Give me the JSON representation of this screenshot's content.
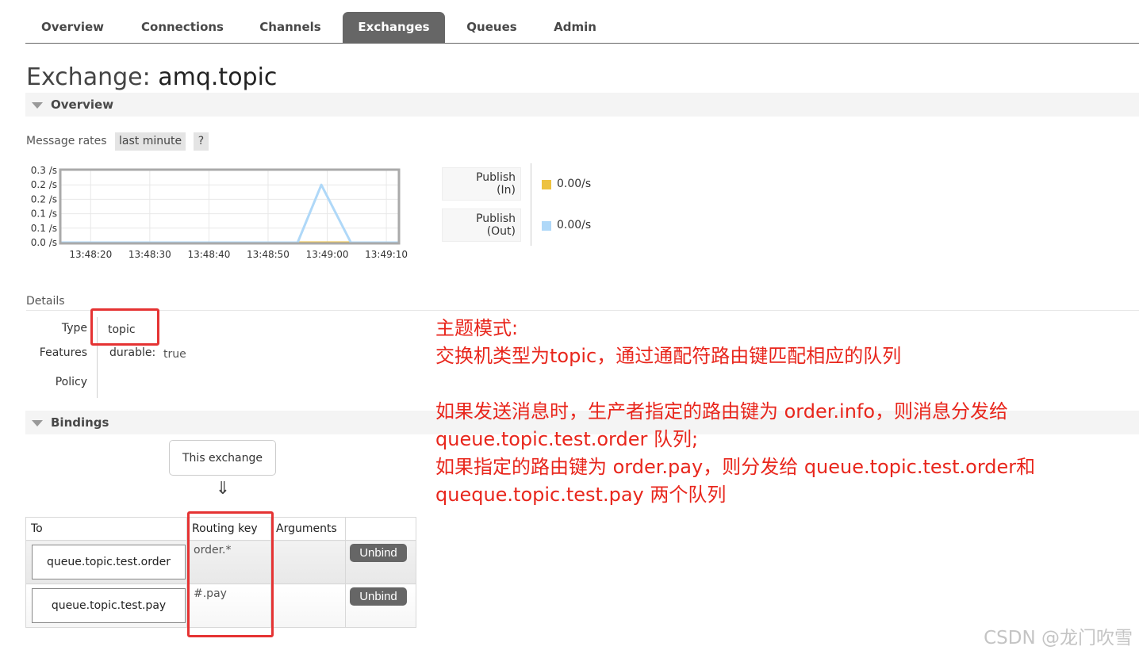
{
  "nav": {
    "tabs": [
      {
        "label": "Overview",
        "active": false
      },
      {
        "label": "Connections",
        "active": false
      },
      {
        "label": "Channels",
        "active": false
      },
      {
        "label": "Exchanges",
        "active": true
      },
      {
        "label": "Queues",
        "active": false
      },
      {
        "label": "Admin",
        "active": false
      }
    ]
  },
  "page": {
    "title_prefix": "Exchange:",
    "title_name": "amq.topic"
  },
  "overview": {
    "header": "Overview",
    "rates_label": "Message rates",
    "rates_range": "last minute",
    "rates_help": "?"
  },
  "chart_data": {
    "type": "line",
    "title": "",
    "xlabel": "",
    "ylabel": "",
    "y_tick_labels": [
      "0.3 /s",
      "0.2 /s",
      "0.2 /s",
      "0.1 /s",
      "0.1 /s",
      "0.0 /s"
    ],
    "x_tick_labels": [
      "13:48:20",
      "13:48:30",
      "13:48:40",
      "13:48:50",
      "13:49:00",
      "13:49:10"
    ],
    "ylim": [
      0,
      0.25
    ],
    "grid": true,
    "series": [
      {
        "name": "Publish (In)",
        "color": "#edc240",
        "points": [
          [
            "13:48:15",
            0
          ],
          [
            "13:49:12",
            0
          ]
        ]
      },
      {
        "name": "Publish (Out)",
        "color": "#afd8f8",
        "points": [
          [
            "13:48:15",
            0
          ],
          [
            "13:48:55",
            0
          ],
          [
            "13:48:59",
            0.2
          ],
          [
            "13:49:04",
            0
          ],
          [
            "13:49:12",
            0
          ]
        ]
      }
    ]
  },
  "legend": {
    "in_label_1": "Publish",
    "in_label_2": "(In)",
    "in_value": "0.00/s",
    "in_color": "#edc240",
    "out_label_1": "Publish",
    "out_label_2": "(Out)",
    "out_value": "0.00/s",
    "out_color": "#afd8f8"
  },
  "details": {
    "label": "Details",
    "type_key": "Type",
    "type_value": "topic",
    "features_key": "Features",
    "feature_name": "durable:",
    "feature_value": "true",
    "policy_key": "Policy"
  },
  "bindings": {
    "header": "Bindings",
    "this_exchange": "This exchange",
    "arrow": "⇓",
    "columns": [
      "To",
      "Routing key",
      "Arguments",
      ""
    ],
    "rows": [
      {
        "to": "queue.topic.test.order",
        "routing_key": "order.*",
        "arguments": "",
        "action": "Unbind"
      },
      {
        "to": "queue.topic.test.pay",
        "routing_key": "#.pay",
        "arguments": "",
        "action": "Unbind"
      }
    ]
  },
  "annotation": {
    "lines": [
      "主题模式:",
      "交换机类型为topic，通过通配符路由键匹配相应的队列",
      "",
      "如果发送消息时，生产者指定的路由键为 order.info，则消息分发给",
      "queue.topic.test.order 队列;",
      "如果指定的路由键为 order.pay，则分发给 queue.topic.test.order和",
      "queque.topic.test.pay 两个队列"
    ]
  },
  "watermark": "CSDN @龙门吹雪"
}
